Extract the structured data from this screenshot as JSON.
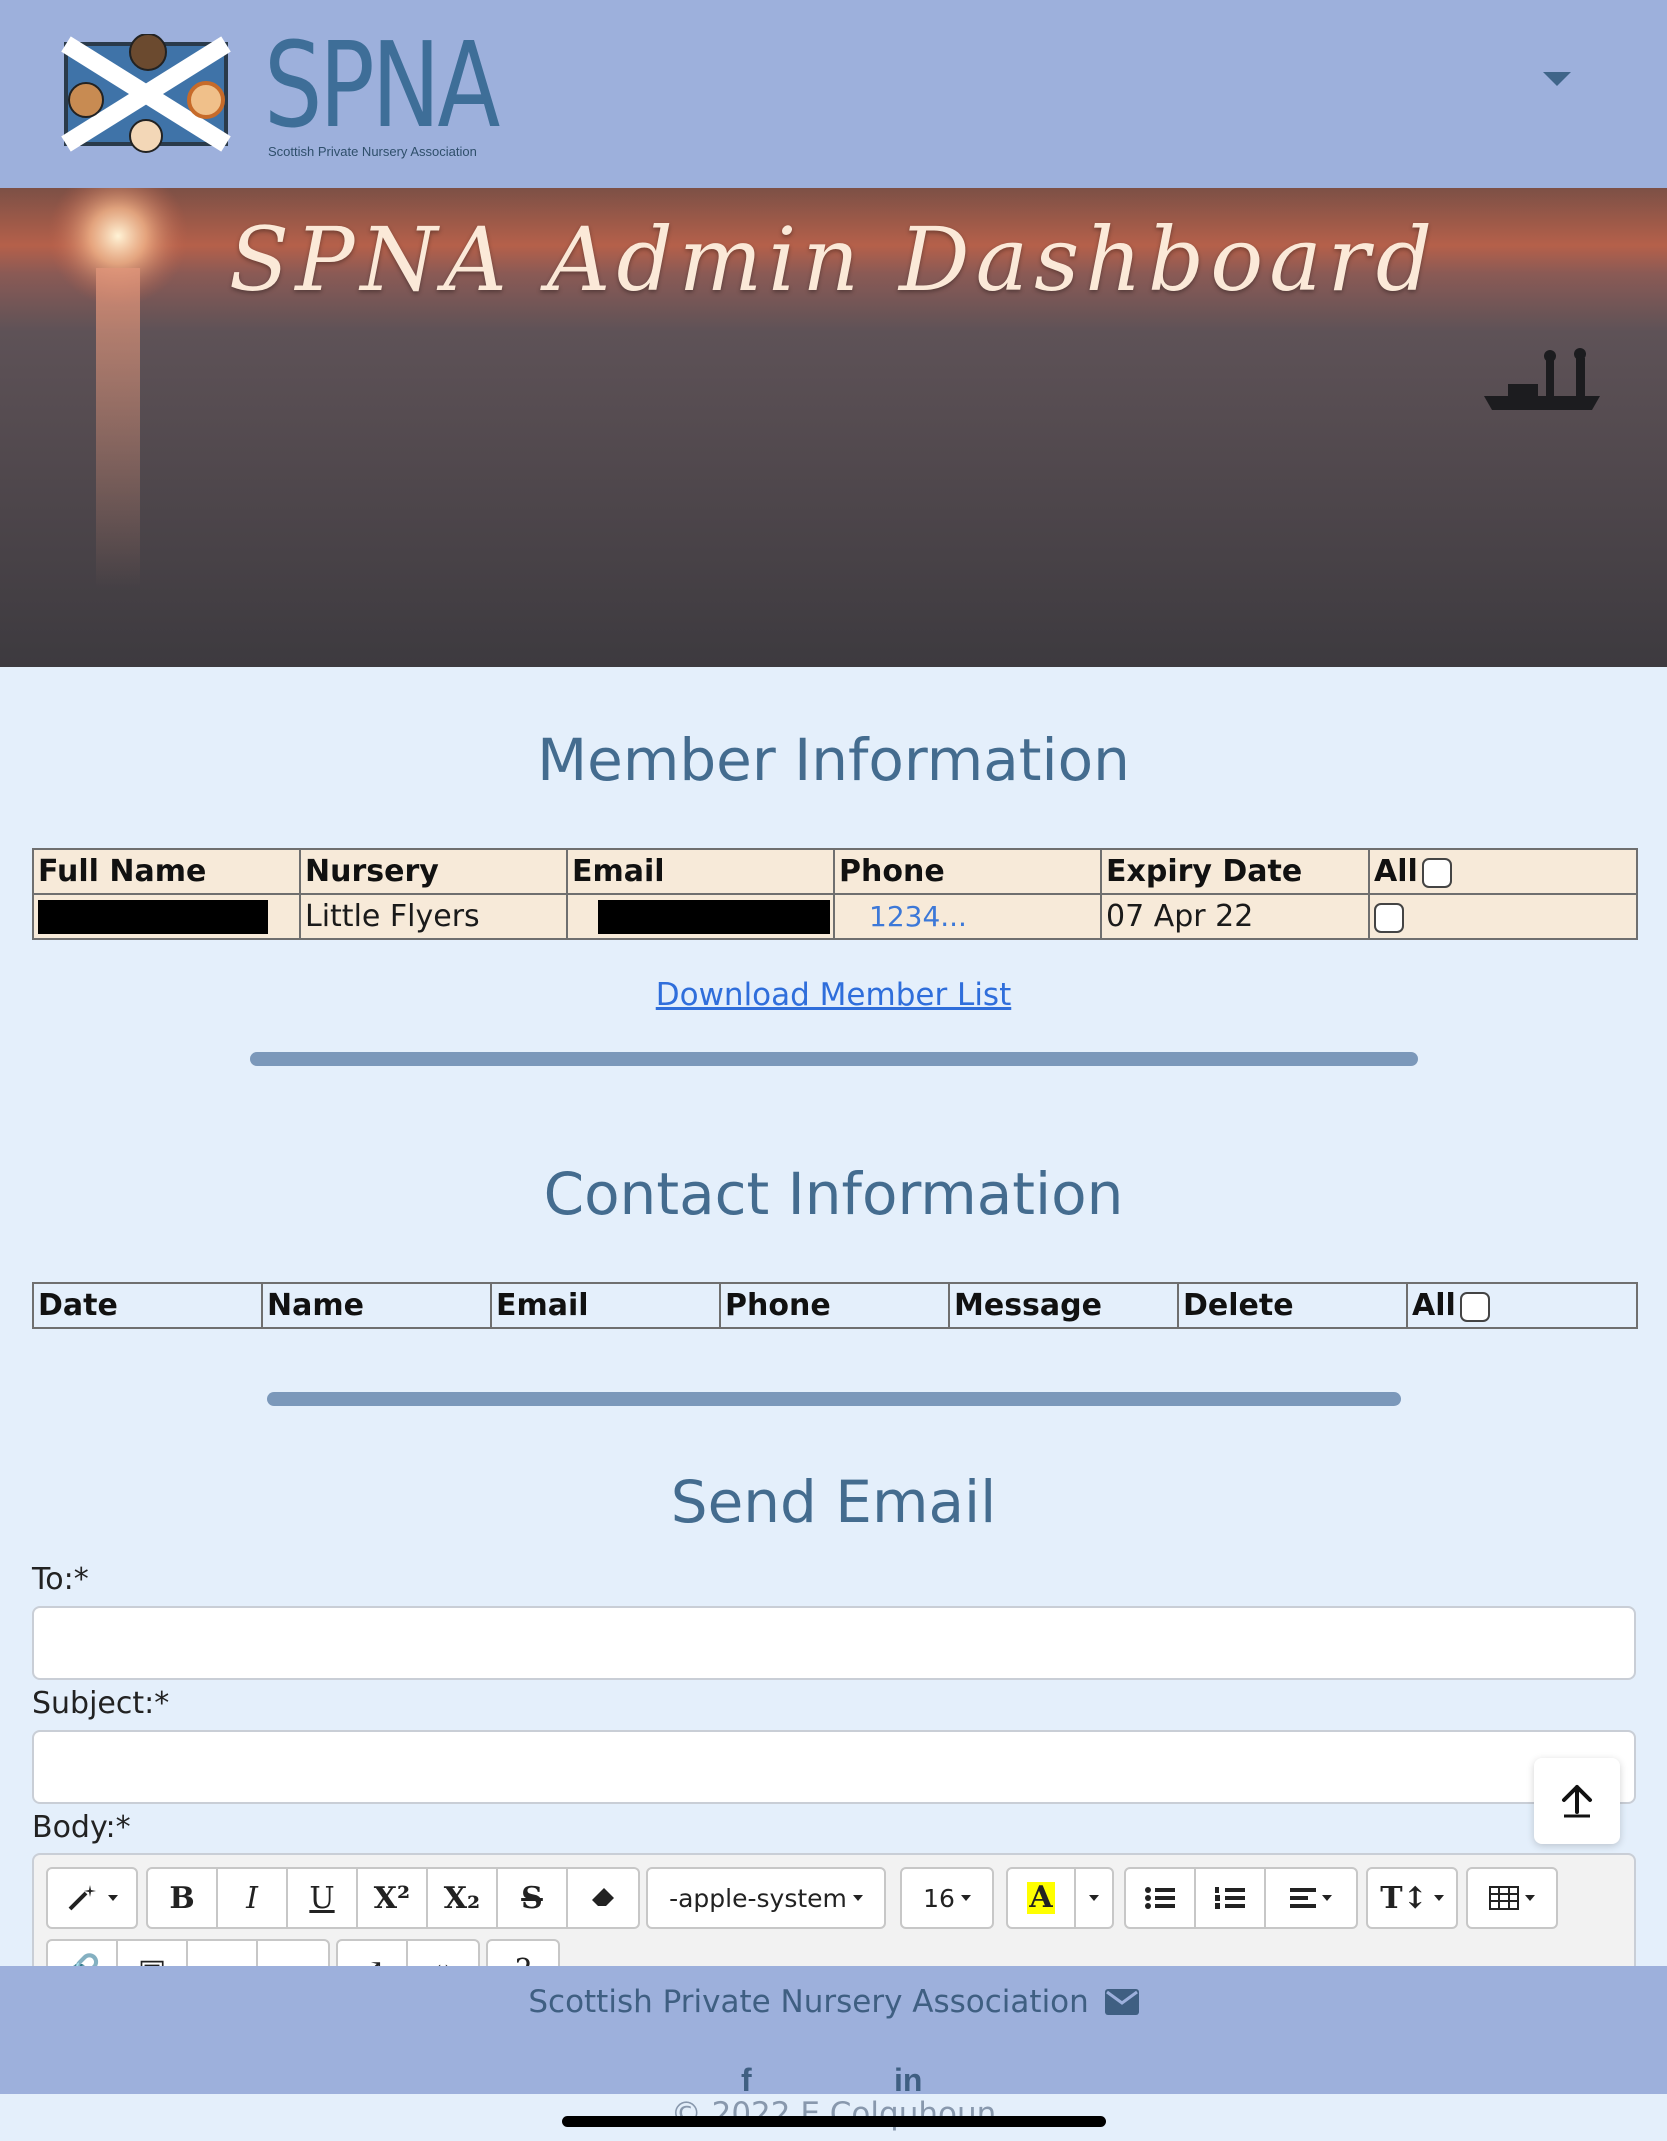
{
  "brand": {
    "logo_text": "SPNA",
    "logo_subtitle": "Scottish Private Nursery Association"
  },
  "hero": {
    "title": "SPNA Admin Dashboard"
  },
  "member_section": {
    "title": "Member Information",
    "columns": [
      "Full Name",
      "Nursery",
      "Email",
      "Phone",
      "Expiry Date",
      "All"
    ],
    "rows": [
      {
        "full_name": "[redacted]",
        "nursery": "Little Flyers",
        "email": "[redacted]",
        "phone": "1234...",
        "expiry_date": "07 Apr 22"
      }
    ],
    "download_link": "Download Member List"
  },
  "contact_section": {
    "title": "Contact Information",
    "columns": [
      "Date",
      "Name",
      "Email",
      "Phone",
      "Message",
      "Delete",
      "All"
    ]
  },
  "email_section": {
    "title": "Send Email",
    "to_label": "To:*",
    "to_value": "",
    "subject_label": "Subject:*",
    "subject_value": "",
    "body_label": "Body:*",
    "toolbar": {
      "font_family": "-apple-system",
      "font_size": "16"
    }
  },
  "footer": {
    "name": "Scottish Private Nursery Association",
    "copyright": "© 2022 E.Colquhoun"
  },
  "colors": {
    "header_bg": "#9db0dc",
    "page_bg": "#e4effb",
    "heading": "#446c8f",
    "link": "#2f6edb"
  }
}
